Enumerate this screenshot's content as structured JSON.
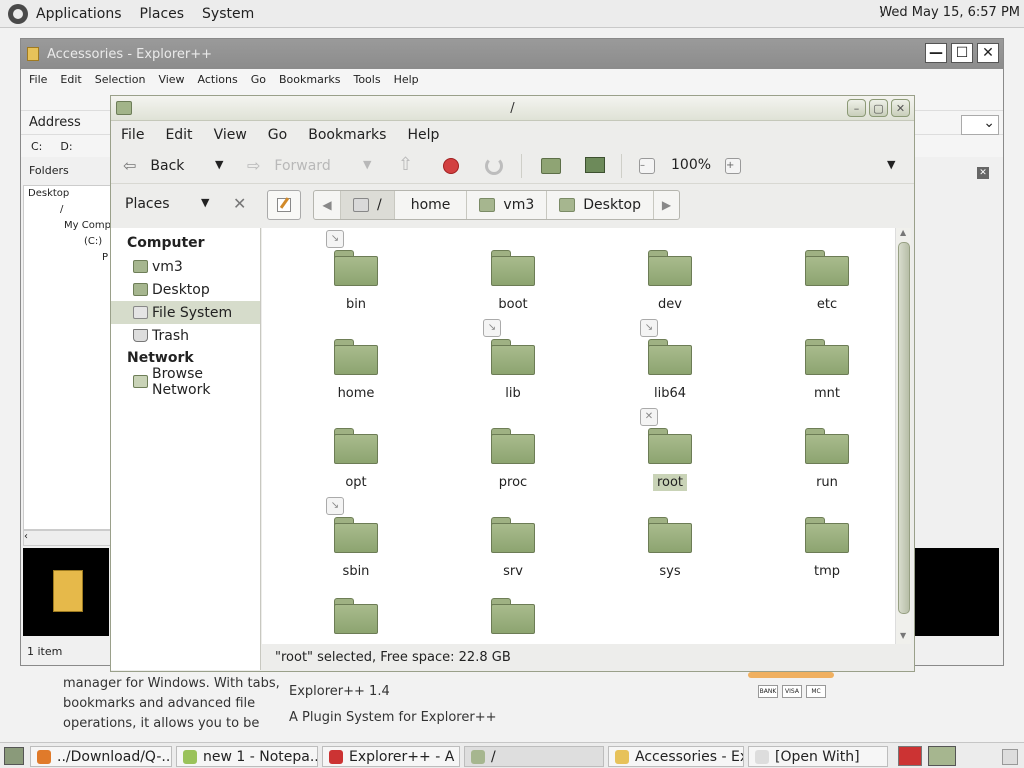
{
  "top_panel": {
    "menus": [
      "Applications",
      "Places",
      "System"
    ],
    "clock": "Wed May 15,  6:57 PM"
  },
  "background_page": {
    "left_text": [
      "manager for Windows. With tabs,",
      "bookmarks and advanced file",
      "operations, it allows you to be"
    ],
    "right_text": [
      "Explorer++ 1.4",
      "A Plugin System for Explorer++"
    ],
    "card_labels": [
      "BANK",
      "VISA",
      "MC"
    ]
  },
  "explorer": {
    "title": "Accessories - Explorer++",
    "menus": [
      "File",
      "Edit",
      "Selection",
      "View",
      "Actions",
      "Go",
      "Bookmarks",
      "Tools",
      "Help"
    ],
    "address_label": "Address",
    "drives": [
      "C:",
      "D:"
    ],
    "folders_label": "Folders",
    "tree": [
      "Desktop",
      "/",
      "My Comp",
      "(C:)",
      "P"
    ],
    "status": "1 item"
  },
  "nautilus": {
    "title": "/",
    "menus": [
      "File",
      "Edit",
      "View",
      "Go",
      "Bookmarks",
      "Help"
    ],
    "toolbar": {
      "back": "Back",
      "forward": "Forward",
      "zoom": "100%"
    },
    "places_label": "Places",
    "breadcrumbs": [
      "/",
      "home",
      "vm3",
      "Desktop"
    ],
    "sidebar": {
      "computer_header": "Computer",
      "computer_items": [
        "vm3",
        "Desktop",
        "File System",
        "Trash"
      ],
      "network_header": "Network",
      "network_items": [
        "Browse Network"
      ]
    },
    "files": [
      {
        "name": "bin",
        "emblem": "link"
      },
      {
        "name": "boot",
        "emblem": ""
      },
      {
        "name": "dev",
        "emblem": ""
      },
      {
        "name": "etc",
        "emblem": ""
      },
      {
        "name": "home",
        "emblem": ""
      },
      {
        "name": "lib",
        "emblem": "link"
      },
      {
        "name": "lib64",
        "emblem": "link"
      },
      {
        "name": "mnt",
        "emblem": ""
      },
      {
        "name": "opt",
        "emblem": ""
      },
      {
        "name": "proc",
        "emblem": ""
      },
      {
        "name": "root",
        "emblem": "no-access",
        "selected": true
      },
      {
        "name": "run",
        "emblem": ""
      },
      {
        "name": "sbin",
        "emblem": "link"
      },
      {
        "name": "srv",
        "emblem": ""
      },
      {
        "name": "sys",
        "emblem": ""
      },
      {
        "name": "tmp",
        "emblem": ""
      },
      {
        "name": "",
        "emblem": ""
      },
      {
        "name": "",
        "emblem": ""
      }
    ],
    "status": "\"root\" selected, Free space: 22.8 GB"
  },
  "taskbar": {
    "tasks": [
      {
        "label": "../Download/Q-...",
        "icon_color": "#e07a2a"
      },
      {
        "label": "new 1 - Notepa...",
        "icon_color": "#9ac25a"
      },
      {
        "label": "Explorer++ - A s...",
        "icon_color": "#cc3333"
      },
      {
        "label": "/",
        "icon_color": "#a6b68f"
      },
      {
        "label": "Accessories - Ex...",
        "icon_color": "#e7c25a"
      },
      {
        "label": "[Open With]",
        "icon_color": "#dddddd"
      }
    ]
  },
  "colors": {
    "folder_green": "#a6b68f",
    "selection": "#d6dccb"
  }
}
